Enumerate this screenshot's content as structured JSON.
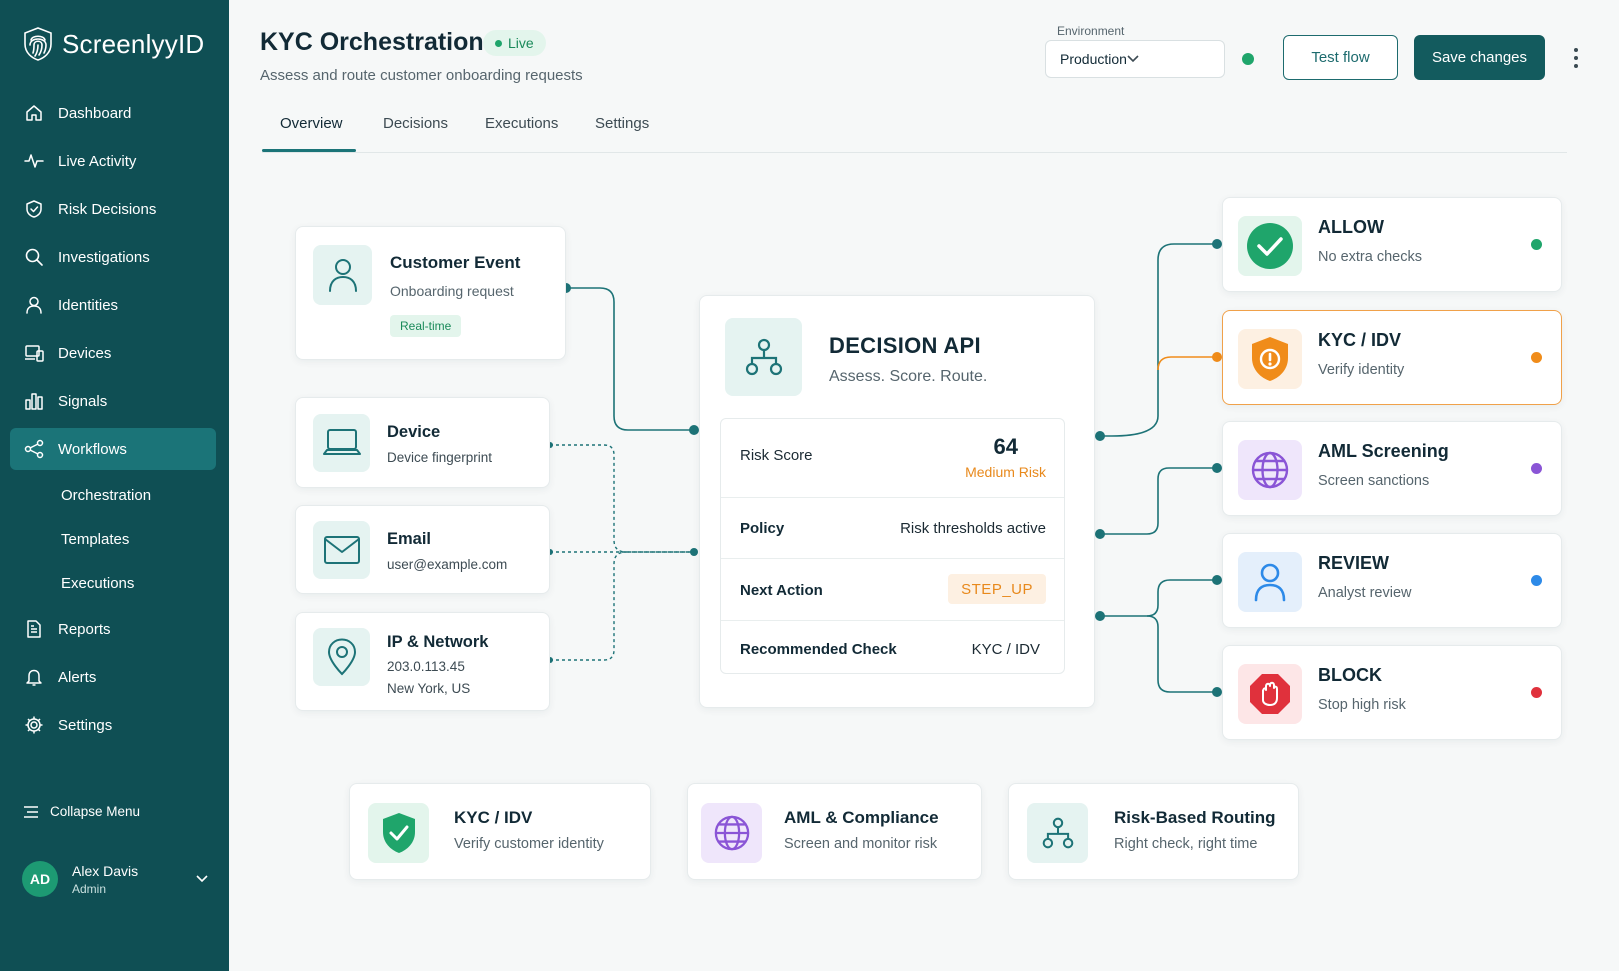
{
  "app": {
    "name": "ScreenlyyID"
  },
  "sidebar": {
    "items": [
      {
        "label": "Dashboard",
        "icon": "home-icon"
      },
      {
        "label": "Live Activity",
        "icon": "pulse-icon"
      },
      {
        "label": "Risk Decisions",
        "icon": "shield-icon"
      },
      {
        "label": "Investigations",
        "icon": "search-icon"
      },
      {
        "label": "Identities",
        "icon": "user-icon"
      },
      {
        "label": "Devices",
        "icon": "devices-icon"
      },
      {
        "label": "Signals",
        "icon": "signals-icon"
      },
      {
        "label": "Workflows",
        "icon": "share-icon",
        "active": true
      },
      {
        "label": "Orchestration",
        "sub": true
      },
      {
        "label": "Templates",
        "sub": true
      },
      {
        "label": "Executions",
        "sub": true
      },
      {
        "label": "Reports",
        "icon": "report-icon"
      },
      {
        "label": "Alerts",
        "icon": "bell-icon"
      },
      {
        "label": "Settings",
        "icon": "gear-icon"
      }
    ],
    "collapse_label": "Collapse Menu",
    "user": {
      "initials": "AD",
      "name": "Alex Davis",
      "role": "Admin"
    }
  },
  "header": {
    "title": "KYC Orchestration",
    "status": "Live",
    "subtitle": "Assess and route customer onboarding requests",
    "environment_label": "Environment",
    "environment_value": "Production",
    "test_button": "Test flow",
    "save_button": "Save changes"
  },
  "tabs": [
    "Overview",
    "Decisions",
    "Executions",
    "Settings"
  ],
  "inputs": {
    "customer_event": {
      "title": "Customer Event",
      "subtitle": "Onboarding request",
      "badge": "Real-time"
    },
    "device": {
      "title": "Device",
      "subtitle": "Device fingerprint"
    },
    "email": {
      "title": "Email",
      "subtitle": "user@example.com"
    },
    "ip": {
      "title": "IP & Network",
      "line1": "203.0.113.45",
      "line2": "New York, US"
    }
  },
  "decision": {
    "title": "DECISION API",
    "subtitle": "Assess. Score. Route.",
    "risk_score_label": "Risk Score",
    "risk_score": "64",
    "risk_level": "Medium Risk",
    "policy_label": "Policy",
    "policy_value": "Risk thresholds active",
    "next_action_label": "Next Action",
    "next_action_value": "STEP_UP",
    "check_label": "Recommended Check",
    "check_value": "KYC / IDV"
  },
  "outcomes": [
    {
      "title": "ALLOW",
      "subtitle": "No extra checks",
      "color": "#1fa56b"
    },
    {
      "title": "KYC / IDV",
      "subtitle": "Verify identity",
      "color": "#f08c1a"
    },
    {
      "title": "AML Screening",
      "subtitle": "Screen sanctions",
      "color": "#8a55d6"
    },
    {
      "title": "REVIEW",
      "subtitle": "Analyst review",
      "color": "#2d8ae8"
    },
    {
      "title": "BLOCK",
      "subtitle": "Stop high risk",
      "color": "#e0313c"
    }
  ],
  "bottom_cards": [
    {
      "title": "KYC / IDV",
      "subtitle": "Verify customer identity"
    },
    {
      "title": "AML & Compliance",
      "subtitle": "Screen and monitor risk"
    },
    {
      "title": "Risk-Based Routing",
      "subtitle": "Right check, right time"
    }
  ],
  "colors": {
    "sidebar": "#0f4f54",
    "accent": "#1b7478",
    "primary_button": "#135b5e",
    "warning": "#e8891c",
    "connector": "#1d7377"
  }
}
